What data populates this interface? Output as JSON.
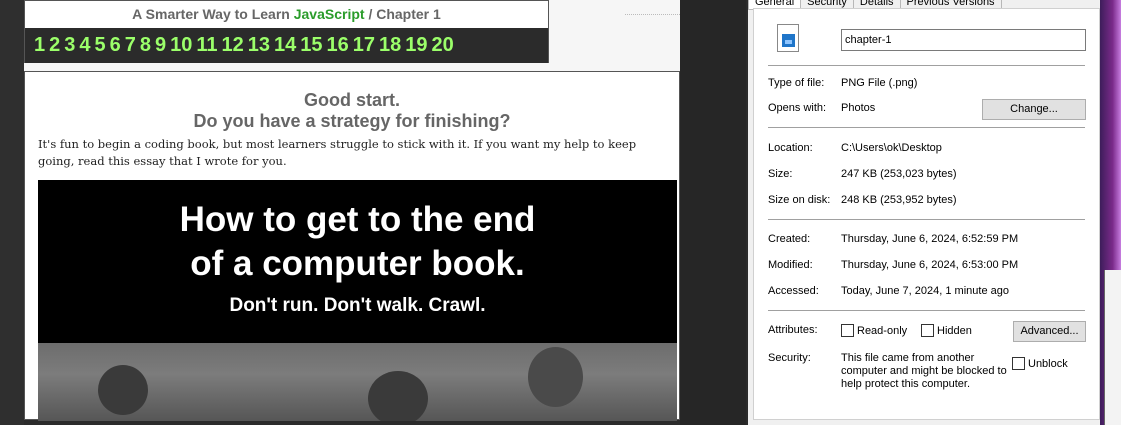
{
  "web": {
    "title_prefix": "A Smarter Way to Learn",
    "title_js": "JavaScript",
    "title_suffix": "/  Chapter 1",
    "chapters": [
      "1",
      "2",
      "3",
      "4",
      "5",
      "6",
      "7",
      "8",
      "9",
      "10",
      "11",
      "12",
      "13",
      "14",
      "15",
      "16",
      "17",
      "18",
      "19",
      "20"
    ],
    "heading1": "Good start.",
    "heading2": "Do you have a strategy for finishing?",
    "body_text": "It's fun to begin a coding book, but most learners struggle to stick with it. If you want my help to keep going, read this essay that I wrote for you.",
    "banner_line1": "How to get to the end",
    "banner_line2": "of a computer book.",
    "banner_line3": "Don't run. Don't walk. Crawl."
  },
  "dialog": {
    "tabs": [
      "General",
      "Security",
      "Details",
      "Previous Versions"
    ],
    "filename": "chapter-1",
    "type_label": "Type of file:",
    "type_value": "PNG File (.png)",
    "opens_label": "Opens with:",
    "opens_value": "Photos",
    "change_button": "Change...",
    "location_label": "Location:",
    "location_value": "C:\\Users\\ok\\Desktop",
    "size_label": "Size:",
    "size_value": "247 KB (253,023 bytes)",
    "size_disk_label": "Size on disk:",
    "size_disk_value": "248 KB (253,952 bytes)",
    "created_label": "Created:",
    "created_value": "Thursday, June 6, 2024, 6:52:59 PM",
    "modified_label": "Modified:",
    "modified_value": "Thursday, June 6, 2024, 6:53:00 PM",
    "accessed_label": "Accessed:",
    "accessed_value": "Today, June 7, 2024, 1 minute ago",
    "attributes_label": "Attributes:",
    "readonly_label": "Read-only",
    "hidden_label": "Hidden",
    "advanced_button": "Advanced...",
    "security_label": "Security:",
    "security_text_1": "This file came from another",
    "security_text_2": "computer and might be blocked to",
    "security_text_3": "help protect this computer.",
    "unblock_label": "Unblock"
  }
}
